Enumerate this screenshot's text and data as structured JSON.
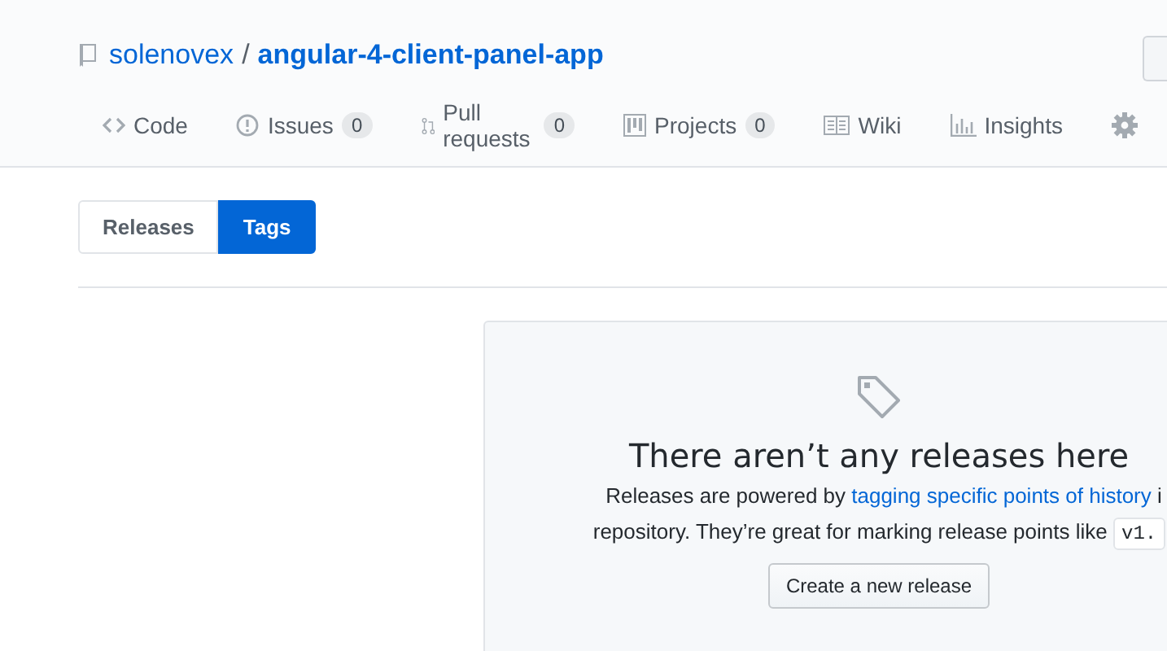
{
  "repo": {
    "owner": "solenovex",
    "separator": "/",
    "name": "angular-4-client-panel-app"
  },
  "nav": [
    {
      "kind": "code",
      "label": "Code",
      "selected": false
    },
    {
      "kind": "issues",
      "label": "Issues",
      "count": "0",
      "selected": false
    },
    {
      "kind": "pulls",
      "label": "Pull requests",
      "count": "0",
      "selected": false
    },
    {
      "kind": "projects",
      "label": "Projects",
      "count": "0",
      "selected": false
    },
    {
      "kind": "wiki",
      "label": "Wiki",
      "selected": false
    },
    {
      "kind": "insights",
      "label": "Insights",
      "selected": false
    },
    {
      "kind": "settings",
      "selected": false
    }
  ],
  "subnav": [
    {
      "label": "Releases",
      "selected": false
    },
    {
      "label": "Tags",
      "selected": true
    }
  ],
  "blankslate": {
    "title": "There aren’t any releases here",
    "text_before": "Releases are powered by",
    "link": "tagging specific points of history",
    "text_after": "i",
    "line_2": "repository. They’re great for marking release points like",
    "code": "v1.",
    "button": "Create a new release"
  }
}
